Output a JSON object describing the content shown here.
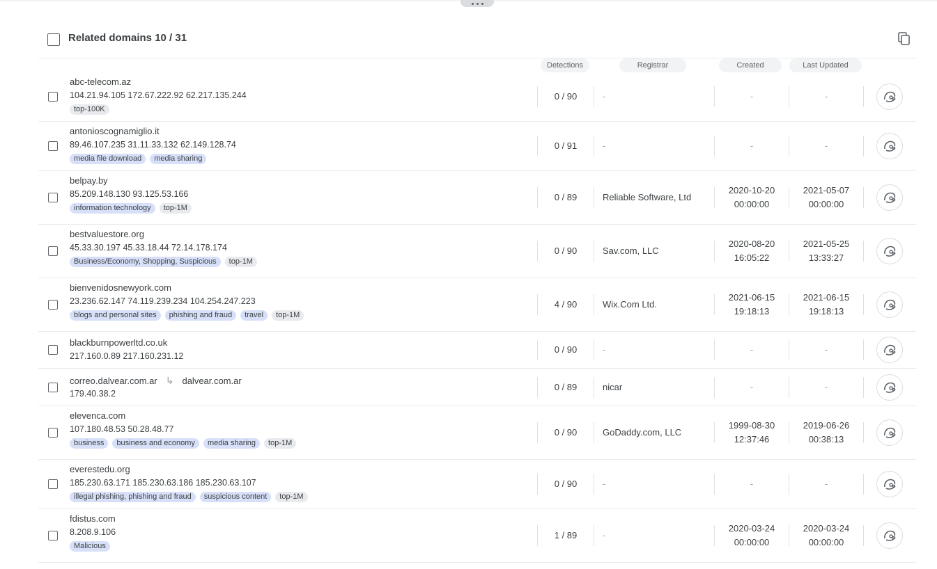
{
  "header": {
    "title": "Related domains 10 / 31"
  },
  "columns": {
    "detections": "Detections",
    "registrar": "Registrar",
    "created": "Created",
    "last_updated": "Last Updated"
  },
  "rows": [
    {
      "domain": "abc-telecom.az",
      "ips": "104.21.94.105 172.67.222.92 62.217.135.244",
      "tags": [
        {
          "label": "top-100K",
          "kind": "grey"
        }
      ],
      "detections": "0 / 90",
      "registrar": "-",
      "created_date": "-",
      "created_time": "",
      "updated_date": "-",
      "updated_time": ""
    },
    {
      "domain": "antonioscognamiglio.it",
      "ips": "89.46.107.235 31.11.33.132 62.149.128.74",
      "tags": [
        {
          "label": "media file download",
          "kind": "blue"
        },
        {
          "label": "media sharing",
          "kind": "blue"
        }
      ],
      "detections": "0 / 91",
      "registrar": "-",
      "created_date": "-",
      "created_time": "",
      "updated_date": "-",
      "updated_time": ""
    },
    {
      "domain": "belpay.by",
      "ips": "85.209.148.130 93.125.53.166",
      "tags": [
        {
          "label": "information technology",
          "kind": "blue"
        },
        {
          "label": "top-1M",
          "kind": "grey"
        }
      ],
      "detections": "0 / 89",
      "registrar": "Reliable Software, Ltd",
      "created_date": "2020-10-20",
      "created_time": "00:00:00",
      "updated_date": "2021-05-07",
      "updated_time": "00:00:00"
    },
    {
      "domain": "bestvaluestore.org",
      "ips": "45.33.30.197 45.33.18.44 72.14.178.174",
      "tags": [
        {
          "label": "Business/Economy, Shopping, Suspicious",
          "kind": "blue"
        },
        {
          "label": "top-1M",
          "kind": "grey"
        }
      ],
      "detections": "0 / 90",
      "registrar": "Sav.com, LLC",
      "created_date": "2020-08-20",
      "created_time": "16:05:22",
      "updated_date": "2021-05-25",
      "updated_time": "13:33:27"
    },
    {
      "domain": "bienvenidosnewyork.com",
      "ips": "23.236.62.147 74.119.239.234 104.254.247.223",
      "tags": [
        {
          "label": "blogs and personal sites",
          "kind": "blue"
        },
        {
          "label": "phishing and fraud",
          "kind": "blue"
        },
        {
          "label": "travel",
          "kind": "blue"
        },
        {
          "label": "top-1M",
          "kind": "grey"
        }
      ],
      "detections": "4 / 90",
      "registrar": "Wix.Com Ltd.",
      "created_date": "2021-06-15",
      "created_time": "19:18:13",
      "updated_date": "2021-06-15",
      "updated_time": "19:18:13"
    },
    {
      "domain": "blackburnpowerltd.co.uk",
      "ips": "217.160.0.89 217.160.231.12",
      "tags": [],
      "detections": "0 / 90",
      "registrar": "-",
      "created_date": "-",
      "created_time": "",
      "updated_date": "-",
      "updated_time": ""
    },
    {
      "domain": "correo.dalvear.com.ar",
      "redirect": "dalvear.com.ar",
      "ips": "179.40.38.2",
      "tags": [],
      "detections": "0 / 89",
      "registrar": "nicar",
      "created_date": "-",
      "created_time": "",
      "updated_date": "-",
      "updated_time": ""
    },
    {
      "domain": "elevenca.com",
      "ips": "107.180.48.53 50.28.48.77",
      "tags": [
        {
          "label": "business",
          "kind": "blue"
        },
        {
          "label": "business and economy",
          "kind": "blue"
        },
        {
          "label": "media sharing",
          "kind": "blue"
        },
        {
          "label": "top-1M",
          "kind": "grey"
        }
      ],
      "detections": "0 / 90",
      "registrar": "GoDaddy.com, LLC",
      "created_date": "1999-08-30",
      "created_time": "12:37:46",
      "updated_date": "2019-06-26",
      "updated_time": "00:38:13"
    },
    {
      "domain": "everestedu.org",
      "ips": "185.230.63.171 185.230.63.186 185.230.63.107",
      "tags": [
        {
          "label": "illegal phishing, phishing and fraud",
          "kind": "blue"
        },
        {
          "label": "suspicious content",
          "kind": "blue"
        },
        {
          "label": "top-1M",
          "kind": "grey"
        }
      ],
      "detections": "0 / 90",
      "registrar": "-",
      "created_date": "-",
      "created_time": "",
      "updated_date": "-",
      "updated_time": ""
    },
    {
      "domain": "fdistus.com",
      "ips": "8.208.9.106",
      "tags": [
        {
          "label": "Malicious",
          "kind": "blue"
        }
      ],
      "detections": "1 / 89",
      "registrar": "-",
      "created_date": "2020-03-24",
      "created_time": "00:00:00",
      "updated_date": "2020-03-24",
      "updated_time": "00:00:00"
    }
  ]
}
